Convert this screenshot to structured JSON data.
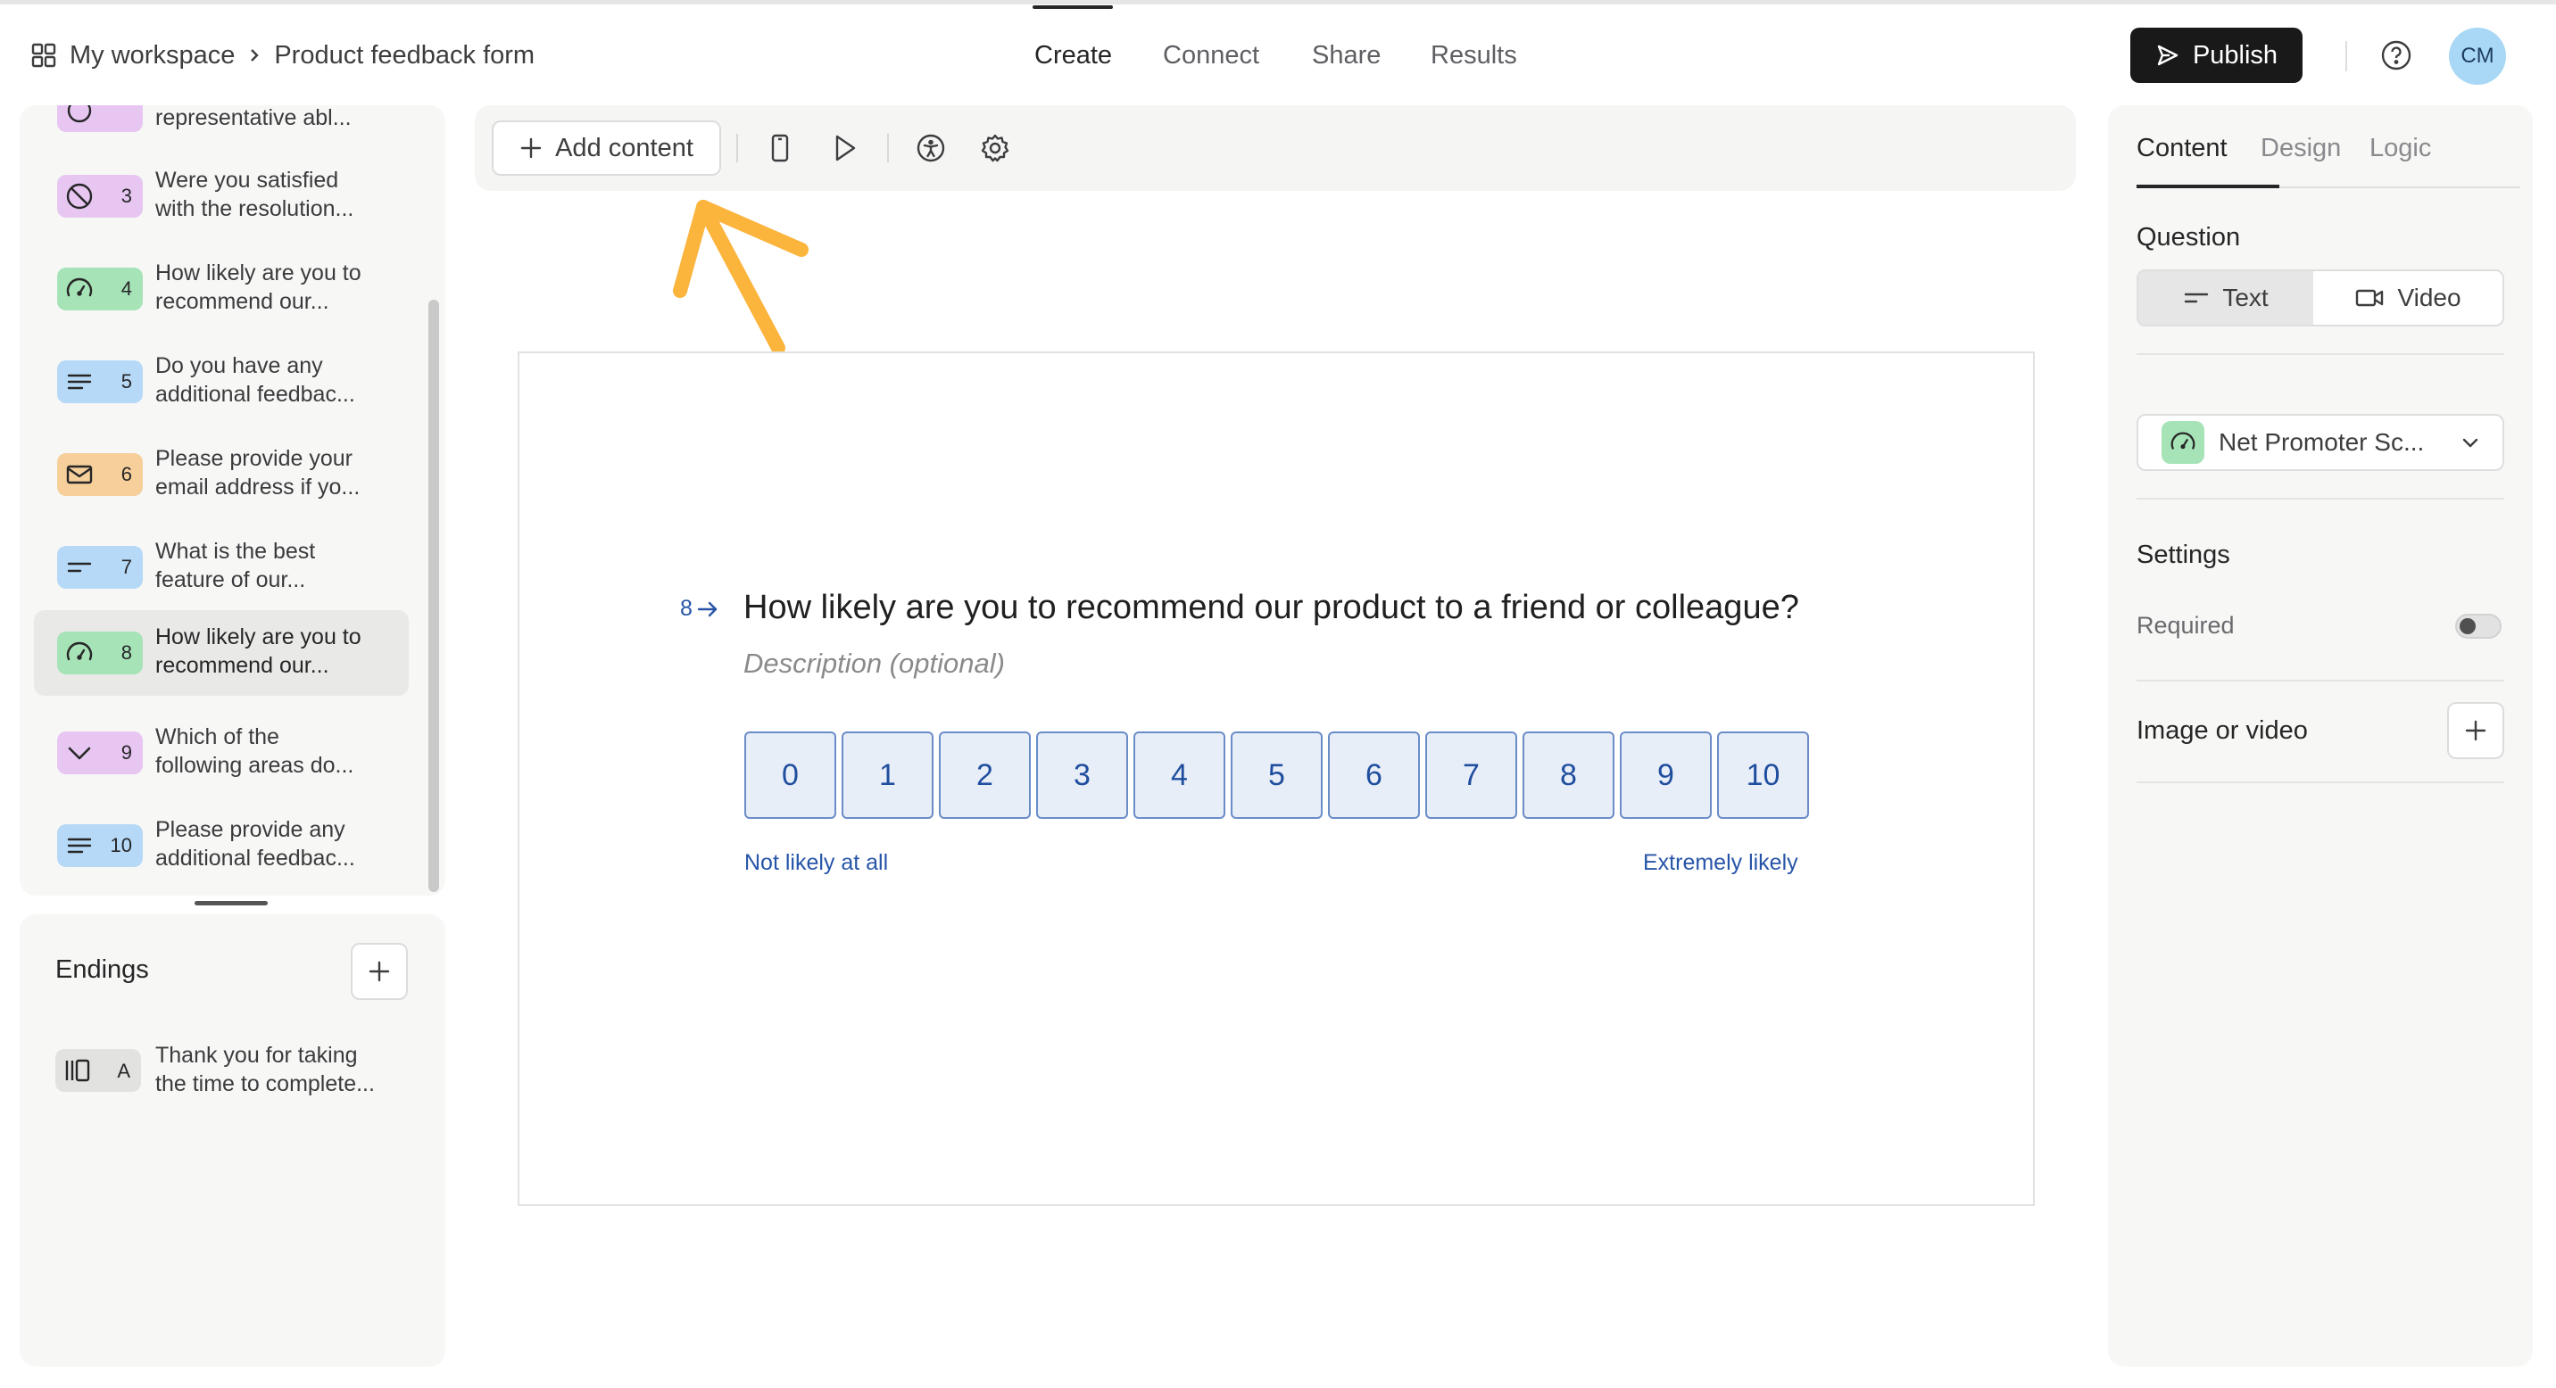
{
  "header": {
    "workspace": "My workspace",
    "form_name": "Product feedback form",
    "tabs": [
      "Create",
      "Connect",
      "Share",
      "Results"
    ],
    "active_tab": "Create",
    "publish_label": "Publish",
    "avatar_initials": "CM"
  },
  "sidebar": {
    "items": [
      {
        "num": "",
        "text_line1": "representative abl...",
        "text_line2": "",
        "type": "opinion-scale"
      },
      {
        "num": "3",
        "text_line1": "Were you satisfied",
        "text_line2": "with the resolution...",
        "type": "yes-no"
      },
      {
        "num": "4",
        "text_line1": "How likely are you to",
        "text_line2": "recommend our...",
        "type": "nps"
      },
      {
        "num": "5",
        "text_line1": "Do you have any",
        "text_line2": "additional feedbac...",
        "type": "long-text"
      },
      {
        "num": "6",
        "text_line1": "Please provide your",
        "text_line2": "email address if yo...",
        "type": "email"
      },
      {
        "num": "7",
        "text_line1": "What is the best",
        "text_line2": "feature of our...",
        "type": "short-text"
      },
      {
        "num": "8",
        "text_line1": "How likely are you to",
        "text_line2": "recommend our...",
        "type": "nps",
        "selected": true
      },
      {
        "num": "9",
        "text_line1": "Which of the",
        "text_line2": "following areas do...",
        "type": "dropdown"
      },
      {
        "num": "10",
        "text_line1": "Please provide any",
        "text_line2": "additional feedbac...",
        "type": "long-text"
      }
    ],
    "endings_title": "Endings",
    "ending": {
      "letter": "A",
      "text_line1": "Thank you for taking",
      "text_line2": "the time to complete..."
    }
  },
  "toolbar": {
    "add_content_label": "Add content"
  },
  "question": {
    "number": "8",
    "title": "How likely are you to recommend our product to a friend or colleague?",
    "description_placeholder": "Description (optional)",
    "scale": [
      "0",
      "1",
      "2",
      "3",
      "4",
      "5",
      "6",
      "7",
      "8",
      "9",
      "10"
    ],
    "label_low": "Not likely at all",
    "label_high": "Extremely likely"
  },
  "right_panel": {
    "tabs": [
      "Content",
      "Design",
      "Logic"
    ],
    "active_tab": "Content",
    "question_label": "Question",
    "question_modes": [
      "Text",
      "Video"
    ],
    "active_mode": "Text",
    "question_type": "Net Promoter Sc...",
    "settings_label": "Settings",
    "required_label": "Required",
    "required_on": false,
    "image_video_label": "Image or video"
  },
  "colors": {
    "accent_blue": "#2755a8",
    "nps_green": "#a6e3b7",
    "yesno_pink": "#e7c6f2",
    "text_blue": "#b6d9f7",
    "email_orange": "#f6cf9a",
    "annotation_arrow": "#fbb43c"
  }
}
